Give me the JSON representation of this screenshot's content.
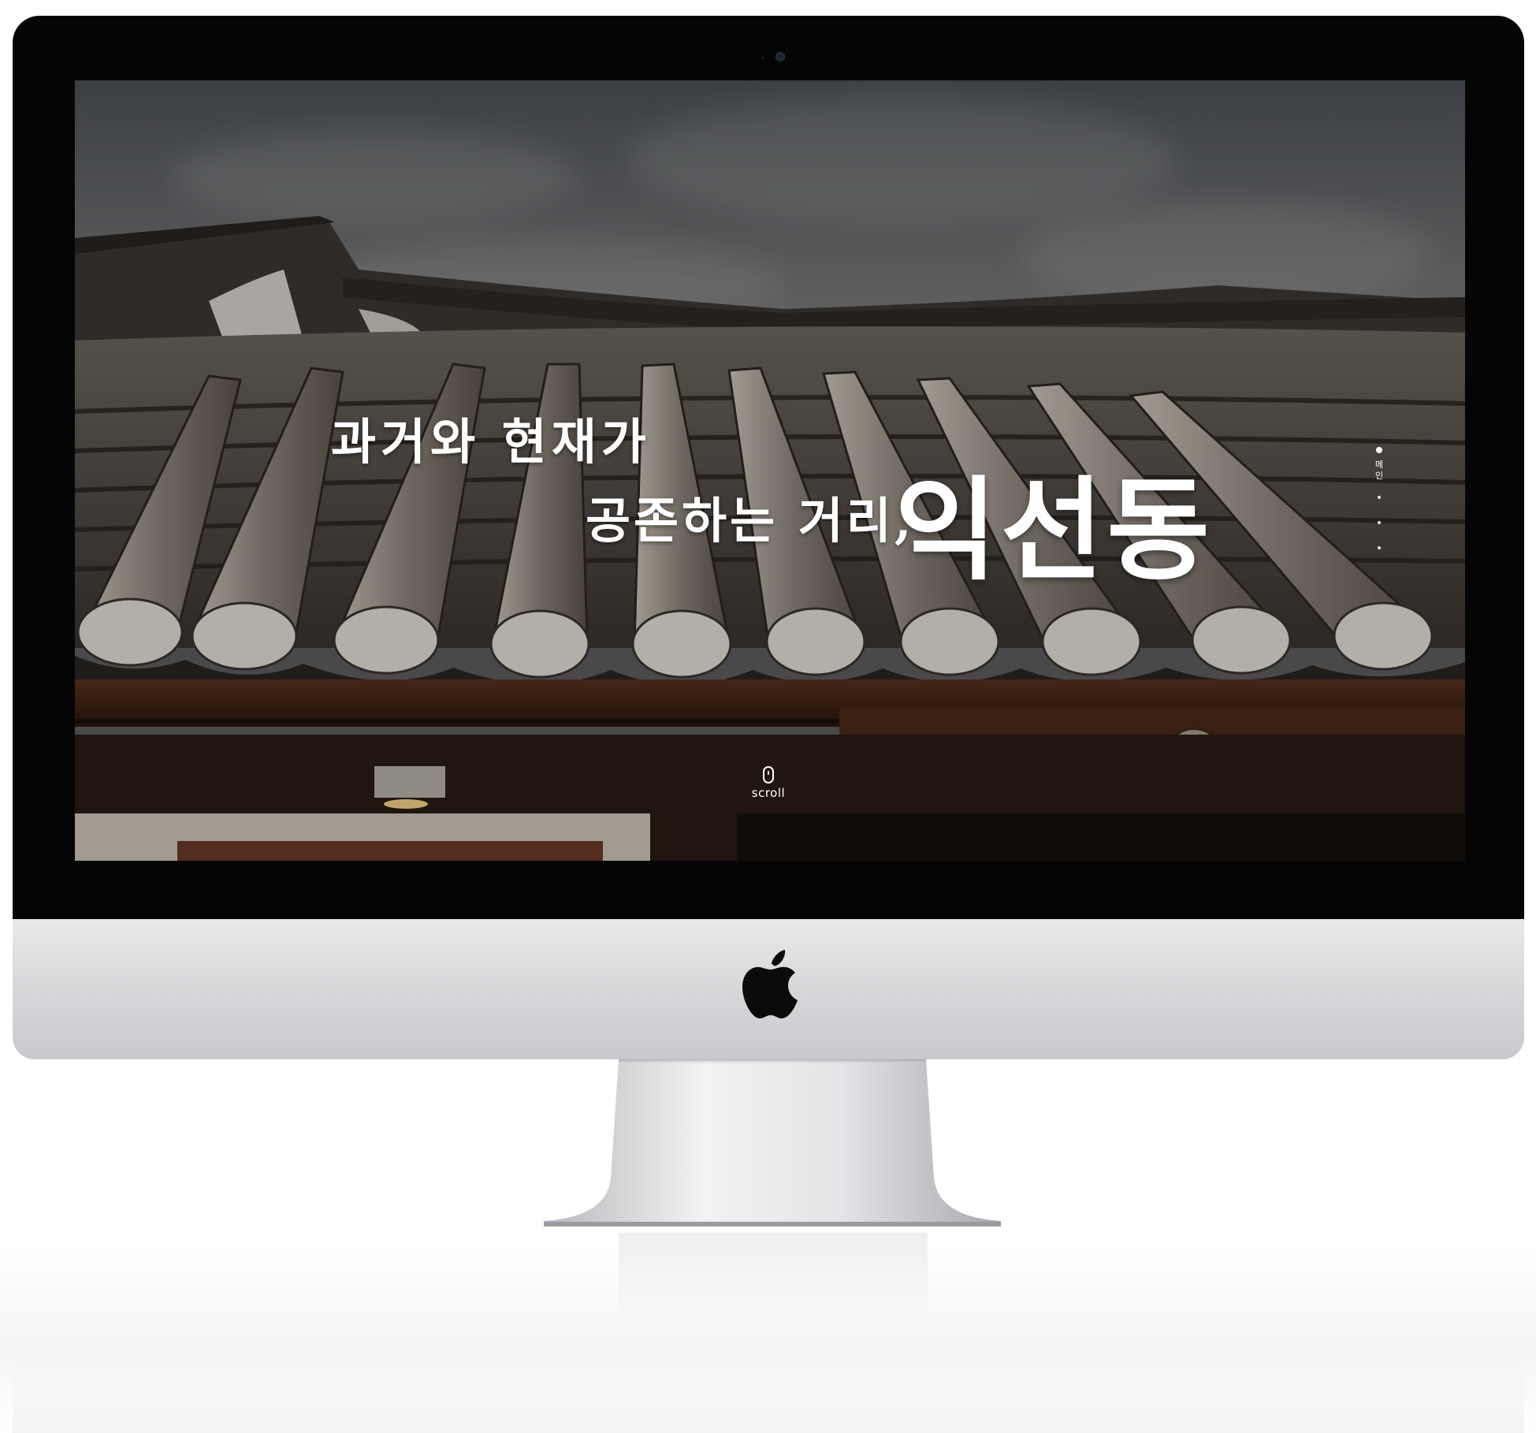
{
  "hero": {
    "line1": "과거와 현재가",
    "line2": "공존하는 거리,",
    "title": "익선동"
  },
  "side_nav": {
    "active_label": "메인"
  },
  "scroll_indicator": {
    "label": "scroll"
  },
  "colors": {
    "bezel": "#050505",
    "chin": "#d9d9dc",
    "hero_text": "#ffffff"
  },
  "icons": [
    "mouse-icon",
    "apple-logo-icon",
    "camera-icon"
  ]
}
